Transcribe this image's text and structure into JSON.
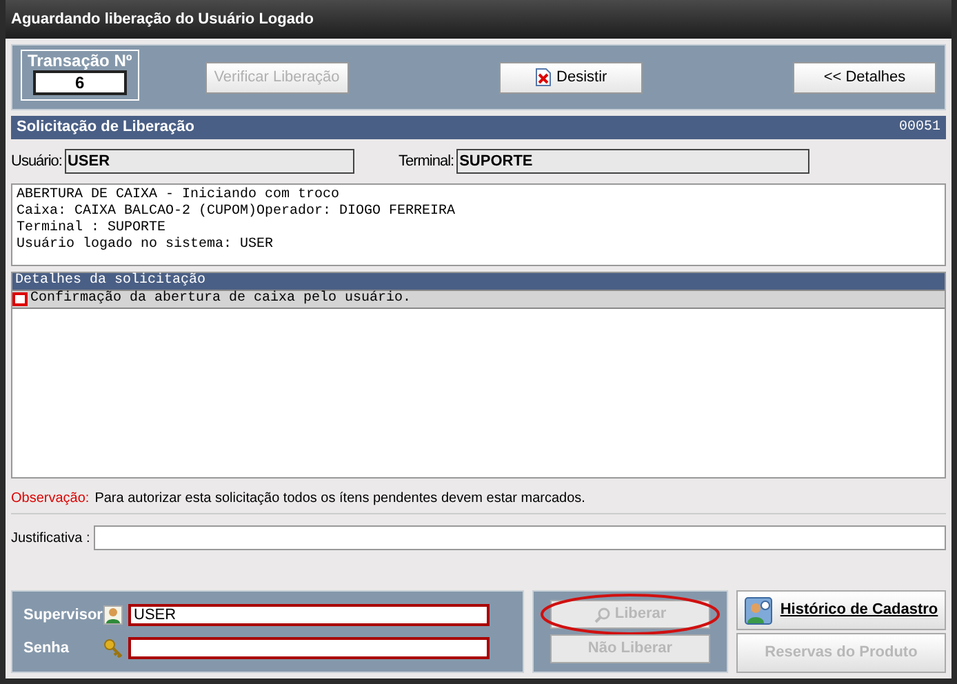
{
  "window": {
    "title": "Aguardando liberação do Usuário Logado"
  },
  "toolbar": {
    "transaction_label": "Transação Nº",
    "transaction_number": "6",
    "buttons": [
      {
        "label": "Verificar Liberação",
        "disabled": true,
        "kind": "plain"
      },
      {
        "label": "Desistir",
        "disabled": false,
        "kind": "cancel"
      },
      {
        "label": "<< Detalhes",
        "disabled": false,
        "kind": "plain"
      }
    ]
  },
  "section": {
    "title": "Solicitação de Liberação",
    "code": "00051"
  },
  "user_field": {
    "label": "Usuário:",
    "value": "USER"
  },
  "terminal_field": {
    "label": "Terminal:",
    "value": "SUPORTE"
  },
  "message_lines": [
    "ABERTURA DE CAIXA - Iniciando com troco",
    "Caixa: CAIXA BALCAO-2 (CUPOM)Operador: DIOGO FERREIRA",
    "Terminal : SUPORTE",
    "Usuário logado no sistema: USER"
  ],
  "details": {
    "title": "Detalhes da solicitação",
    "items": [
      {
        "text": "Confirmação da abertura de caixa pelo usuário.",
        "checked": false,
        "selected": true
      }
    ]
  },
  "observation": {
    "label": "Observação:",
    "text": "Para autorizar esta solicitação todos os ítens pendentes devem estar marcados."
  },
  "justification": {
    "label": "Justificativa :"
  },
  "login": {
    "supervisor_label": "Supervisor",
    "supervisor_value": "USER",
    "password_label": "Senha"
  },
  "actions": [
    {
      "label": "Liberar",
      "disabled": true,
      "highlighted": true
    },
    {
      "label": "Não Liberar",
      "disabled": true,
      "highlighted": false
    }
  ],
  "side_buttons": [
    {
      "label": "Histórico de Cadastro",
      "disabled": false
    },
    {
      "label": "Reservas do Produto",
      "disabled": true
    }
  ]
}
